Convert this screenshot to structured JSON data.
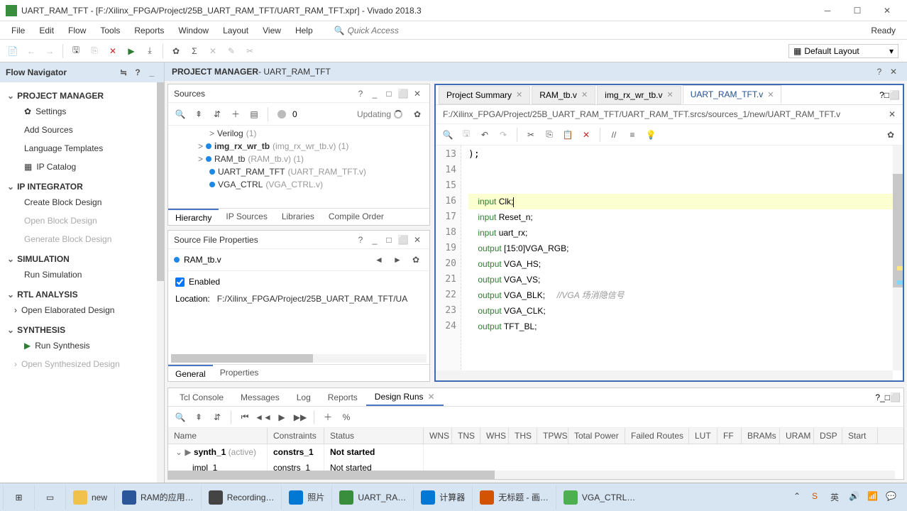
{
  "title": "UART_RAM_TFT - [F:/Xilinx_FPGA/Project/25B_UART_RAM_TFT/UART_RAM_TFT.xpr] - Vivado 2018.3",
  "menus": [
    "File",
    "Edit",
    "Flow",
    "Tools",
    "Reports",
    "Window",
    "Layout",
    "View",
    "Help"
  ],
  "quick_access_placeholder": "Quick Access",
  "ready": "Ready",
  "layout_dropdown": "Default Layout",
  "flow_nav": {
    "title": "Flow Navigator",
    "sections": [
      {
        "label": "PROJECT MANAGER",
        "items": [
          {
            "label": "Settings",
            "icon": "gear"
          },
          {
            "label": "Add Sources"
          },
          {
            "label": "Language Templates"
          },
          {
            "label": "IP Catalog",
            "icon": "chip"
          }
        ]
      },
      {
        "label": "IP INTEGRATOR",
        "items": [
          {
            "label": "Create Block Design"
          },
          {
            "label": "Open Block Design",
            "disabled": true
          },
          {
            "label": "Generate Block Design",
            "disabled": true
          }
        ]
      },
      {
        "label": "SIMULATION",
        "items": [
          {
            "label": "Run Simulation"
          }
        ]
      },
      {
        "label": "RTL ANALYSIS",
        "items": [
          {
            "label": "Open Elaborated Design",
            "caret": true
          }
        ]
      },
      {
        "label": "SYNTHESIS",
        "items": [
          {
            "label": "Run Synthesis",
            "icon": "play"
          },
          {
            "label": "Open Synthesized Design",
            "caret": true,
            "disabled": true
          }
        ]
      }
    ]
  },
  "project_header": {
    "prefix": "PROJECT MANAGER",
    "suffix": " - UART_RAM_TFT"
  },
  "sources": {
    "title": "Sources",
    "updating": "Updating",
    "tree": [
      {
        "indent": 3,
        "caret": ">",
        "label": "Verilog",
        "suffix": "(1)"
      },
      {
        "indent": 2,
        "caret": ">",
        "dot": true,
        "label": "img_rx_wr_tb",
        "bold": true,
        "suffix": "(img_rx_wr_tb.v) (1)"
      },
      {
        "indent": 2,
        "caret": ">",
        "dot": true,
        "label": "RAM_tb",
        "suffix": "(RAM_tb.v) (1)"
      },
      {
        "indent": 3,
        "dot": true,
        "label": "UART_RAM_TFT",
        "suffix": "(UART_RAM_TFT.v)"
      },
      {
        "indent": 3,
        "dot": true,
        "label": "VGA_CTRL",
        "suffix": "(VGA_CTRL.v)"
      }
    ],
    "tabs": [
      "Hierarchy",
      "IP Sources",
      "Libraries",
      "Compile Order"
    ],
    "active_tab": 0,
    "zero": "0"
  },
  "props": {
    "title": "Source File Properties",
    "file": "RAM_tb.v",
    "enabled_label": "Enabled",
    "location_label": "Location:",
    "location_value": "F:/Xilinx_FPGA/Project/25B_UART_RAM_TFT/UA",
    "tabs": [
      "General",
      "Properties"
    ],
    "active_tab": 0
  },
  "editor": {
    "tabs": [
      {
        "label": "Project Summary"
      },
      {
        "label": "RAM_tb.v"
      },
      {
        "label": "img_rx_wr_tb.v"
      },
      {
        "label": "UART_RAM_TFT.v",
        "active": true
      }
    ],
    "path": "F:/Xilinx_FPGA/Project/25B_UART_RAM_TFT/UART_RAM_TFT.srcs/sources_1/new/UART_RAM_TFT.v",
    "first_line": 13,
    "lines": [
      {
        "text": ");"
      },
      {
        "text": ""
      },
      {
        "text": "    "
      },
      {
        "text": "    input Clk;",
        "hl": true,
        "kw": "input",
        "rest": " Clk;"
      },
      {
        "text": "    input Reset_n;",
        "kw": "input",
        "rest": " Reset_n;"
      },
      {
        "text": "    input uart_rx;",
        "kw": "input",
        "rest": " uart_rx;"
      },
      {
        "text": "    output [15:0]VGA_RGB;",
        "kw": "output",
        "rest": " [15:0]VGA_RGB;"
      },
      {
        "text": "    output VGA_HS;",
        "kw": "output",
        "rest": " VGA_HS;"
      },
      {
        "text": "    output VGA_VS;",
        "kw": "output",
        "rest": " VGA_VS;"
      },
      {
        "text": "    output VGA_BLK;",
        "kw": "output",
        "rest": " VGA_BLK;     ",
        "comment": "//VGA 场消隐信号"
      },
      {
        "text": "    output VGA_CLK;",
        "kw": "output",
        "rest": " VGA_CLK;"
      },
      {
        "text": "    output TFT_BL;",
        "kw": "output",
        "rest": " TFT_BL;"
      }
    ]
  },
  "bottom": {
    "tabs": [
      "Tcl Console",
      "Messages",
      "Log",
      "Reports",
      "Design Runs"
    ],
    "active_tab": 4,
    "cols": [
      "Name",
      "Constraints",
      "Status",
      "WNS",
      "TNS",
      "WHS",
      "THS",
      "TPWS",
      "Total Power",
      "Failed Routes",
      "LUT",
      "FF",
      "BRAMs",
      "URAM",
      "DSP",
      "Start"
    ],
    "rows": [
      {
        "name": "synth_1",
        "suffix": "(active)",
        "caret": "v",
        "constraints": "constrs_1",
        "status": "Not started",
        "bold": true
      },
      {
        "name": "impl_1",
        "indent": true,
        "constraints": "constrs_1",
        "status": "Not started"
      }
    ]
  },
  "taskbar": {
    "items": [
      {
        "label": "new",
        "icon": "folder"
      },
      {
        "label": "RAM的应用…",
        "icon": "word"
      },
      {
        "label": "Recording…",
        "icon": "camtasia"
      },
      {
        "label": "照片",
        "icon": "photos"
      },
      {
        "label": "UART_RA…",
        "icon": "vivado"
      },
      {
        "label": "计算器",
        "icon": "calc"
      },
      {
        "label": "无标题 - 画…",
        "icon": "paint"
      },
      {
        "label": "VGA_CTRL…",
        "icon": "notepad"
      }
    ]
  }
}
